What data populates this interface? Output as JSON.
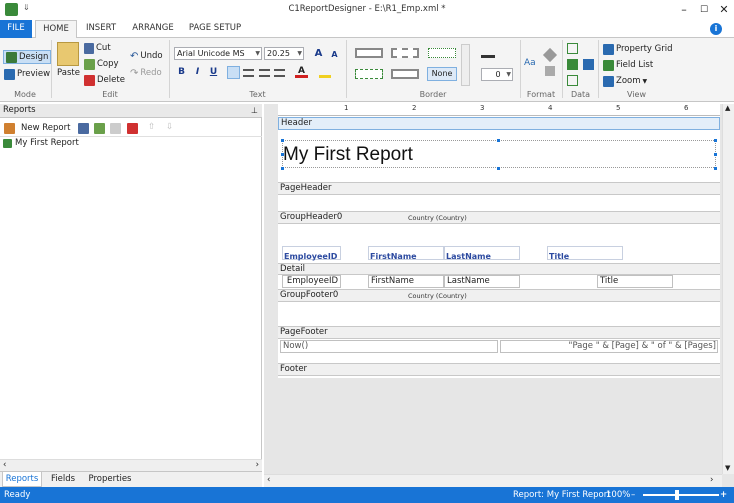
{
  "window": {
    "title": "C1ReportDesigner - E:\\R1_Emp.xml *",
    "qat": "⇓",
    "minimize": "–",
    "maximize": "☐",
    "close": "✕"
  },
  "tabs": [
    "FILE",
    "HOME",
    "INSERT",
    "ARRANGE",
    "PAGE SETUP"
  ],
  "info": "i",
  "ribbon": {
    "mode": {
      "design": "Design",
      "preview": "Preview",
      "label": "Mode"
    },
    "edit": {
      "paste": "Paste",
      "cut": "Cut",
      "copy": "Copy",
      "delete": "Delete",
      "undo": "Undo",
      "redo": "Redo",
      "label": "Edit"
    },
    "text": {
      "font": "Arial Unicode MS",
      "size": "20.25",
      "bold": "B",
      "italic": "I",
      "underline": "U",
      "grow": "A",
      "shrink": "A",
      "fontcolor": "A",
      "label": "Text"
    },
    "border": {
      "none": "None",
      "width": "0",
      "label": "Border"
    },
    "format": {
      "label": "Format",
      "aa": "Aa"
    },
    "data": {
      "label": "Data"
    },
    "view": {
      "property_grid": "Property Grid",
      "field_list": "Field List",
      "zoom": "Zoom",
      "label": "View"
    }
  },
  "left": {
    "header": "Reports",
    "pin": "📌",
    "new_report": "New Report",
    "item": "My First Report",
    "tabs": [
      "Reports",
      "Fields",
      "Properties"
    ]
  },
  "ruler": [
    "1",
    "2",
    "3",
    "4",
    "5",
    "6"
  ],
  "report": {
    "header_band": "Header",
    "title": "My First Report",
    "pageheader_band": "PageHeader",
    "groupheader_band": "GroupHeader0",
    "group_caption": "Country (Country)",
    "col_headers": [
      "EmployeeID",
      "FirstName",
      "LastName",
      "Title"
    ],
    "detail_band": "Detail",
    "detail_fields": [
      "EmployeeID",
      "FirstName",
      "LastName",
      "Title"
    ],
    "groupfooter_band": "GroupFooter0",
    "groupfooter_caption": "Country (Country)",
    "pagefooter_band": "PageFooter",
    "now": "Now()",
    "pages": "\"Page \" & [Page] & \" of \" & [Pages]",
    "footer_band": "Footer"
  },
  "status": {
    "left": "Ready",
    "report": "Report: My First Report",
    "zoom": "100%"
  }
}
